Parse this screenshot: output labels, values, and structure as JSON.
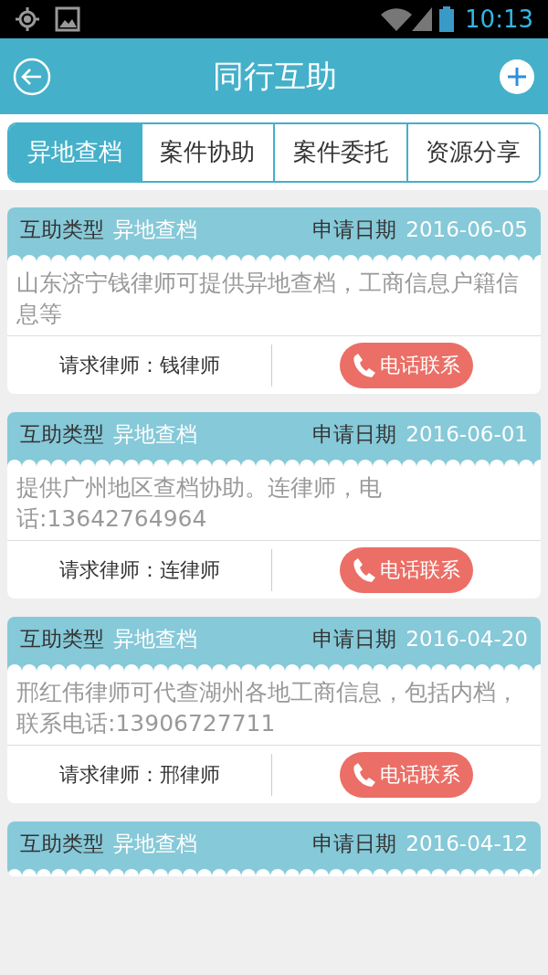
{
  "status_bar": {
    "time": "10:13"
  },
  "header": {
    "title": "同行互助"
  },
  "tabs": [
    {
      "label": "异地查档",
      "selected": true
    },
    {
      "label": "案件协助",
      "selected": false
    },
    {
      "label": "案件委托",
      "selected": false
    },
    {
      "label": "资源分享",
      "selected": false
    }
  ],
  "cards": [
    {
      "type_label": "互助类型",
      "type_value": "异地查档",
      "date_label": "申请日期",
      "date": "2016-06-05",
      "description": "山东济宁钱律师可提供异地查档，工商信息户籍信息等",
      "lawyer": "请求律师：钱律师",
      "button": "电话联系"
    },
    {
      "type_label": "互助类型",
      "type_value": "异地查档",
      "date_label": "申请日期",
      "date": "2016-06-01",
      "description": "提供广州地区查档协助。连律师，电话:13642764964",
      "lawyer": "请求律师：连律师",
      "button": "电话联系"
    },
    {
      "type_label": "互助类型",
      "type_value": "异地查档",
      "date_label": "申请日期",
      "date": "2016-04-20",
      "description": "邢红伟律师可代查湖州各地工商信息，包括内档，联系电话:13906727711",
      "lawyer": "请求律师：邢律师",
      "button": "电话联系"
    },
    {
      "type_label": "互助类型",
      "type_value": "异地查档",
      "date_label": "申请日期",
      "date": "2016-04-12"
    }
  ]
}
